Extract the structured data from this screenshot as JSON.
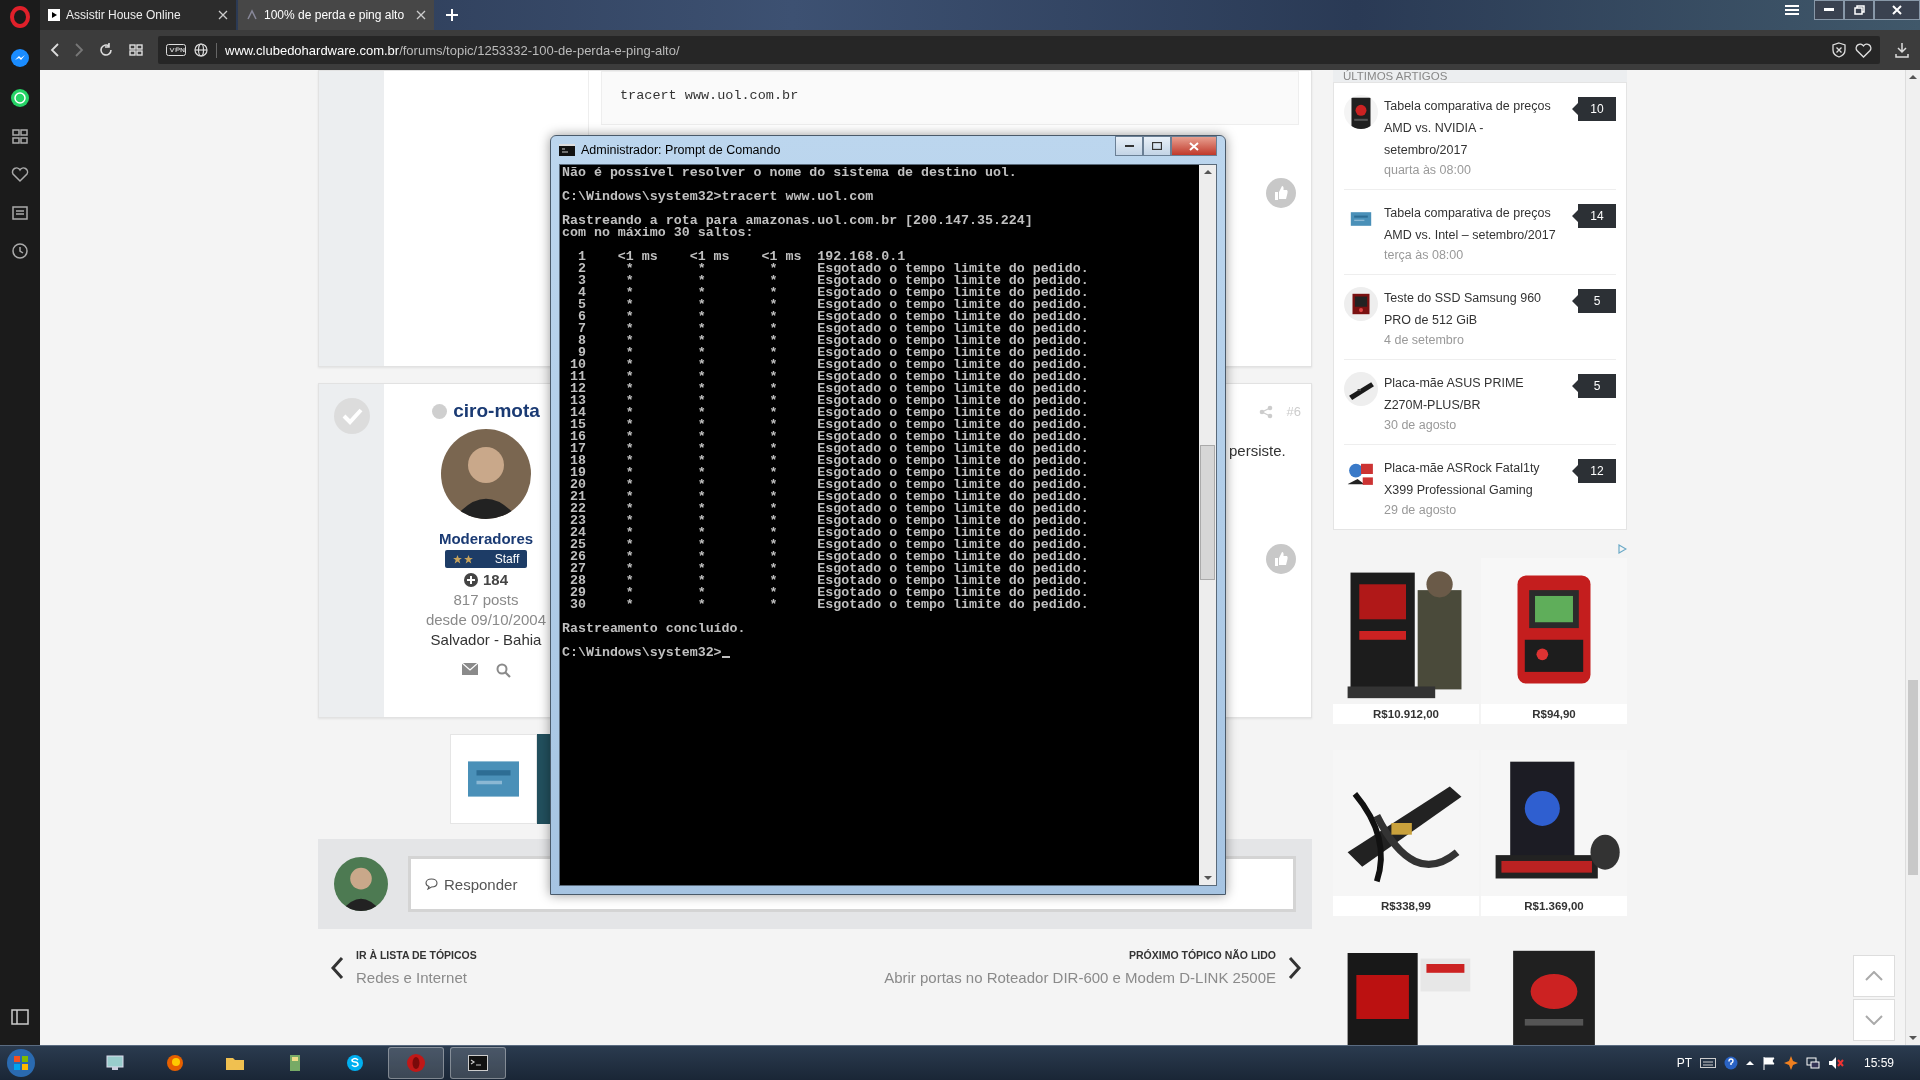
{
  "browser": {
    "tabs": [
      {
        "label": "Assistir House Online",
        "selected": false
      },
      {
        "label": "100% de perda e ping alto",
        "selected": true
      }
    ],
    "address": {
      "host": "www.clubedohardware.com.br",
      "path": "/forums/topic/1253332-100-de-perda-e-ping-alto/"
    }
  },
  "post_1": {
    "code": "tracert www.uol.com.br"
  },
  "post_2": {
    "author": "ciro-mota",
    "online": false,
    "group": "Moderadores",
    "badge": "Staff",
    "reputation": "184",
    "posts": "817 posts",
    "since": "desde 09/10/2004",
    "location": "Salvador - Bahia",
    "number": "#6",
    "text_fragment": "persiste."
  },
  "reply": {
    "placeholder": "Responder"
  },
  "navigation": {
    "previous": {
      "label": "IR À LISTA DE TÓPICOS",
      "title": "Redes e Internet"
    },
    "next": {
      "label": "PRÓXIMO TÓPICO NÃO LIDO",
      "title": "Abrir portas no Roteador DIR-600 e Modem D-LINK 2500E"
    }
  },
  "sidebar": {
    "title": "ÚLTIMOS ARTIGOS",
    "articles": [
      {
        "title": "Tabela comparativa de preços AMD vs. NVIDIA - setembro/2017",
        "date": "quarta às 08:00",
        "comments": "10"
      },
      {
        "title": "Tabela comparativa de preços AMD vs. Intel – setembro/2017",
        "date": "terça às 08:00",
        "comments": "14"
      },
      {
        "title": "Teste do SSD Samsung 960 PRO de 512 GiB",
        "date": "4 de setembro",
        "comments": "5"
      },
      {
        "title": "Placa-mãe ASUS PRIME Z270M-PLUS/BR",
        "date": "30 de agosto",
        "comments": "5"
      },
      {
        "title": "Placa-mãe ASRock Fatal1ty X399 Professional Gaming",
        "date": "29 de agosto",
        "comments": "12"
      }
    ]
  },
  "ads": [
    {
      "kind": "product",
      "price": "R$10.912,00"
    },
    {
      "kind": "product",
      "price": "R$94,90"
    },
    {
      "kind": "product",
      "price": "R$338,99"
    },
    {
      "kind": "product",
      "price": "R$1.369,00"
    },
    {
      "kind": "picture"
    },
    {
      "kind": "picture"
    }
  ],
  "console": {
    "title": "Administrador: Prompt de Comando",
    "blocks": [
      [
        "Não é possível resolver o nome do sistema de destino uol."
      ],
      [
        "C:\\Windows\\system32>tracert www.uol.com"
      ],
      [
        "Rastreando a rota para amazonas.uol.com.br [200.147.35.224]",
        "com no máximo 30 saltos:"
      ],
      [
        "  1    <1 ms    <1 ms    <1 ms  192.168.0.1",
        "  2     *        *        *     Esgotado o tempo limite do pedido.",
        "  3     *        *        *     Esgotado o tempo limite do pedido.",
        "  4     *        *        *     Esgotado o tempo limite do pedido.",
        "  5     *        *        *     Esgotado o tempo limite do pedido.",
        "  6     *        *        *     Esgotado o tempo limite do pedido.",
        "  7     *        *        *     Esgotado o tempo limite do pedido.",
        "  8     *        *        *     Esgotado o tempo limite do pedido.",
        "  9     *        *        *     Esgotado o tempo limite do pedido.",
        " 10     *        *        *     Esgotado o tempo limite do pedido.",
        " 11     *        *        *     Esgotado o tempo limite do pedido.",
        " 12     *        *        *     Esgotado o tempo limite do pedido.",
        " 13     *        *        *     Esgotado o tempo limite do pedido.",
        " 14     *        *        *     Esgotado o tempo limite do pedido.",
        " 15     *        *        *     Esgotado o tempo limite do pedido.",
        " 16     *        *        *     Esgotado o tempo limite do pedido.",
        " 17     *        *        *     Esgotado o tempo limite do pedido.",
        " 18     *        *        *     Esgotado o tempo limite do pedido.",
        " 19     *        *        *     Esgotado o tempo limite do pedido.",
        " 20     *        *        *     Esgotado o tempo limite do pedido.",
        " 21     *        *        *     Esgotado o tempo limite do pedido.",
        " 22     *        *        *     Esgotado o tempo limite do pedido.",
        " 23     *        *        *     Esgotado o tempo limite do pedido.",
        " 24     *        *        *     Esgotado o tempo limite do pedido.",
        " 25     *        *        *     Esgotado o tempo limite do pedido.",
        " 26     *        *        *     Esgotado o tempo limite do pedido.",
        " 27     *        *        *     Esgotado o tempo limite do pedido.",
        " 28     *        *        *     Esgotado o tempo limite do pedido.",
        " 29     *        *        *     Esgotado o tempo limite do pedido.",
        " 30     *        *        *     Esgotado o tempo limite do pedido."
      ],
      [
        "Rastreamento concluído."
      ],
      [
        "C:\\Windows\\system32>"
      ]
    ]
  },
  "taskbar": {
    "language": "PT",
    "time": "15:59"
  }
}
